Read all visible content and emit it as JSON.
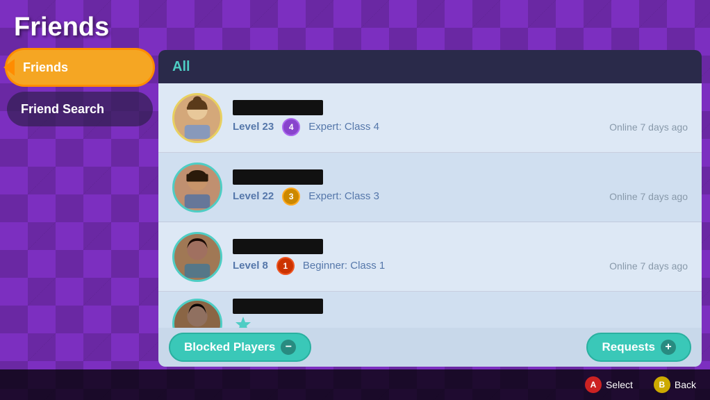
{
  "page": {
    "title": "Friends",
    "bg_color": "#7c2fc0"
  },
  "sidebar": {
    "items": [
      {
        "id": "friends",
        "label": "Friends",
        "active": true
      },
      {
        "id": "friend-search",
        "label": "Friend Search",
        "active": false
      }
    ]
  },
  "main": {
    "tab_label": "All",
    "friends": [
      {
        "id": 1,
        "name_redacted": true,
        "level": "Level 23",
        "rank_num": "4",
        "rank_label": "Expert: Class 4",
        "online": "Online 7 days ago",
        "avatar_style": "avatar-1"
      },
      {
        "id": 2,
        "name_redacted": true,
        "level": "Level 22",
        "rank_num": "3",
        "rank_label": "Expert: Class 3",
        "online": "Online 7 days ago",
        "avatar_style": "avatar-2"
      },
      {
        "id": 3,
        "name_redacted": true,
        "level": "Level 8",
        "rank_num": "1",
        "rank_label": "Beginner: Class 1",
        "online": "Online 7 days ago",
        "avatar_style": "avatar-3"
      },
      {
        "id": 4,
        "name_redacted": true,
        "level": "",
        "rank_num": "",
        "rank_label": "",
        "online": "",
        "avatar_style": "avatar-4"
      }
    ],
    "buttons": {
      "blocked": "Blocked Players",
      "blocked_icon": "−",
      "requests": "Requests",
      "requests_icon": "+"
    }
  },
  "bottom_bar": {
    "actions": [
      {
        "badge": "A",
        "label": "Select",
        "color": "badge-a"
      },
      {
        "badge": "B",
        "label": "Back",
        "color": "badge-b"
      }
    ]
  }
}
